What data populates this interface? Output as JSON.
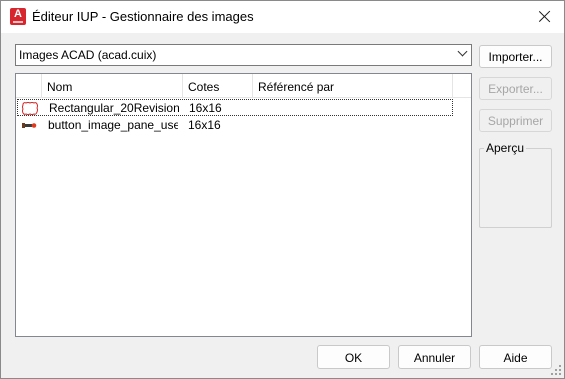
{
  "window": {
    "title": "Éditeur IUP - Gestionnaire des images",
    "app_icon": "autocad-logo-icon"
  },
  "combo": {
    "value": "Images ACAD (acad.cuix)"
  },
  "list": {
    "columns": [
      "Nom",
      "Cotes",
      "Référencé par"
    ],
    "rows": [
      {
        "name": "Rectangular_20Revision…",
        "size": "16x16",
        "icon": "revision-cloud-icon",
        "selected": true
      },
      {
        "name": "button_image_pane_use…",
        "size": "16x16",
        "icon": "button-image-icon",
        "selected": false
      }
    ]
  },
  "side_buttons": {
    "import": "Importer...",
    "export": "Exporter...",
    "delete": "Supprimer"
  },
  "preview": {
    "label": "Aperçu"
  },
  "footer": {
    "ok": "OK",
    "cancel": "Annuler",
    "help": "Aide"
  }
}
